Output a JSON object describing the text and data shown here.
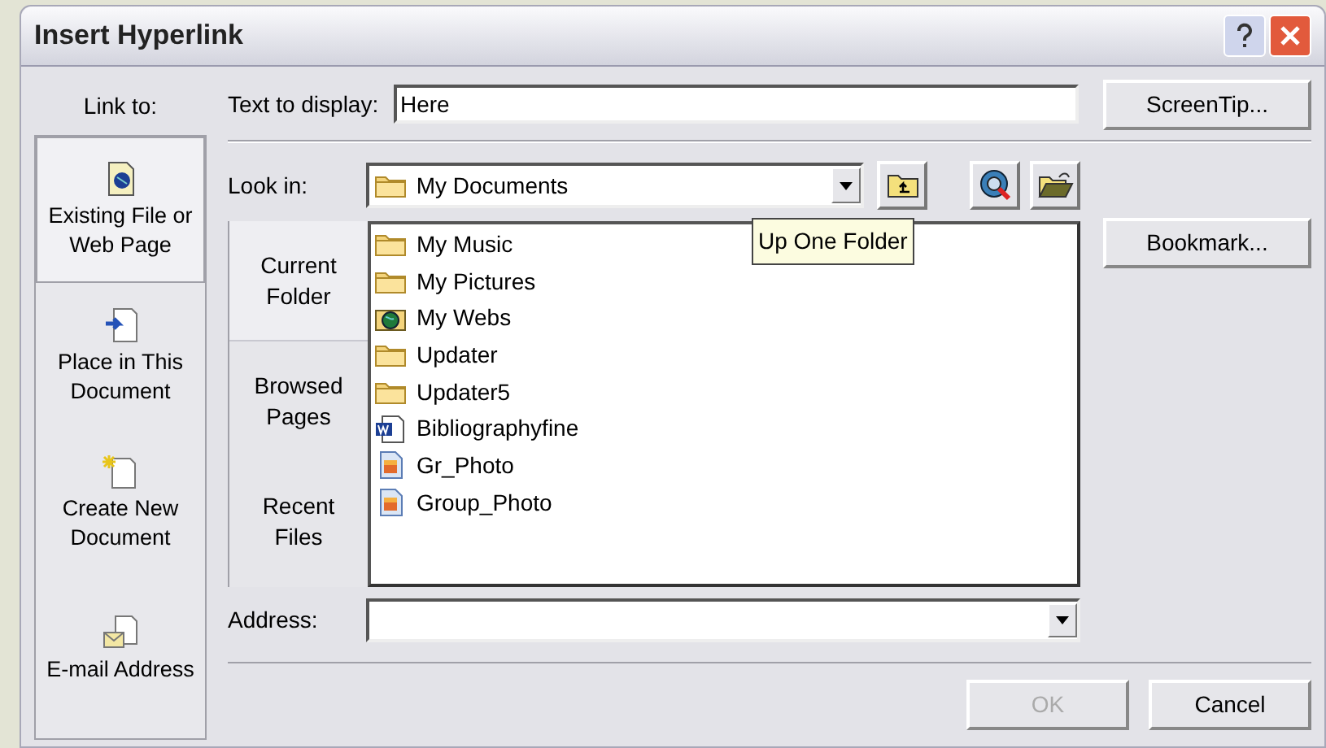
{
  "window": {
    "title": "Insert Hyperlink"
  },
  "link_to": {
    "label": "Link to:",
    "items": [
      {
        "label": "Existing File or Web Page",
        "kind": "file",
        "selected": true
      },
      {
        "label": "Place in This Document",
        "kind": "place",
        "selected": false
      },
      {
        "label": "Create New Document",
        "kind": "new",
        "selected": false
      },
      {
        "label": "E-mail Address",
        "kind": "email",
        "selected": false
      }
    ]
  },
  "text_to_display": {
    "label": "Text to display:",
    "value": "Here"
  },
  "look_in": {
    "label": "Look in:",
    "value": "My Documents"
  },
  "tooltip": "Up One Folder",
  "sub_nav": [
    {
      "label": "Current Folder",
      "selected": true
    },
    {
      "label": "Browsed Pages",
      "selected": false
    },
    {
      "label": "Recent Files",
      "selected": false
    }
  ],
  "files": [
    {
      "name": "My Music",
      "kind": "folder"
    },
    {
      "name": "My Pictures",
      "kind": "folder"
    },
    {
      "name": "My Webs",
      "kind": "web"
    },
    {
      "name": "Updater",
      "kind": "folder"
    },
    {
      "name": "Updater5",
      "kind": "folder"
    },
    {
      "name": "Bibliographyfine",
      "kind": "word"
    },
    {
      "name": "Gr_Photo",
      "kind": "image"
    },
    {
      "name": "Group_Photo",
      "kind": "image"
    }
  ],
  "address": {
    "label": "Address:"
  },
  "side_buttons": [
    "ScreenTip...",
    "Bookmark..."
  ],
  "footer_buttons": [
    {
      "label": "OK",
      "disabled": true
    },
    {
      "label": "Cancel",
      "disabled": false
    }
  ]
}
